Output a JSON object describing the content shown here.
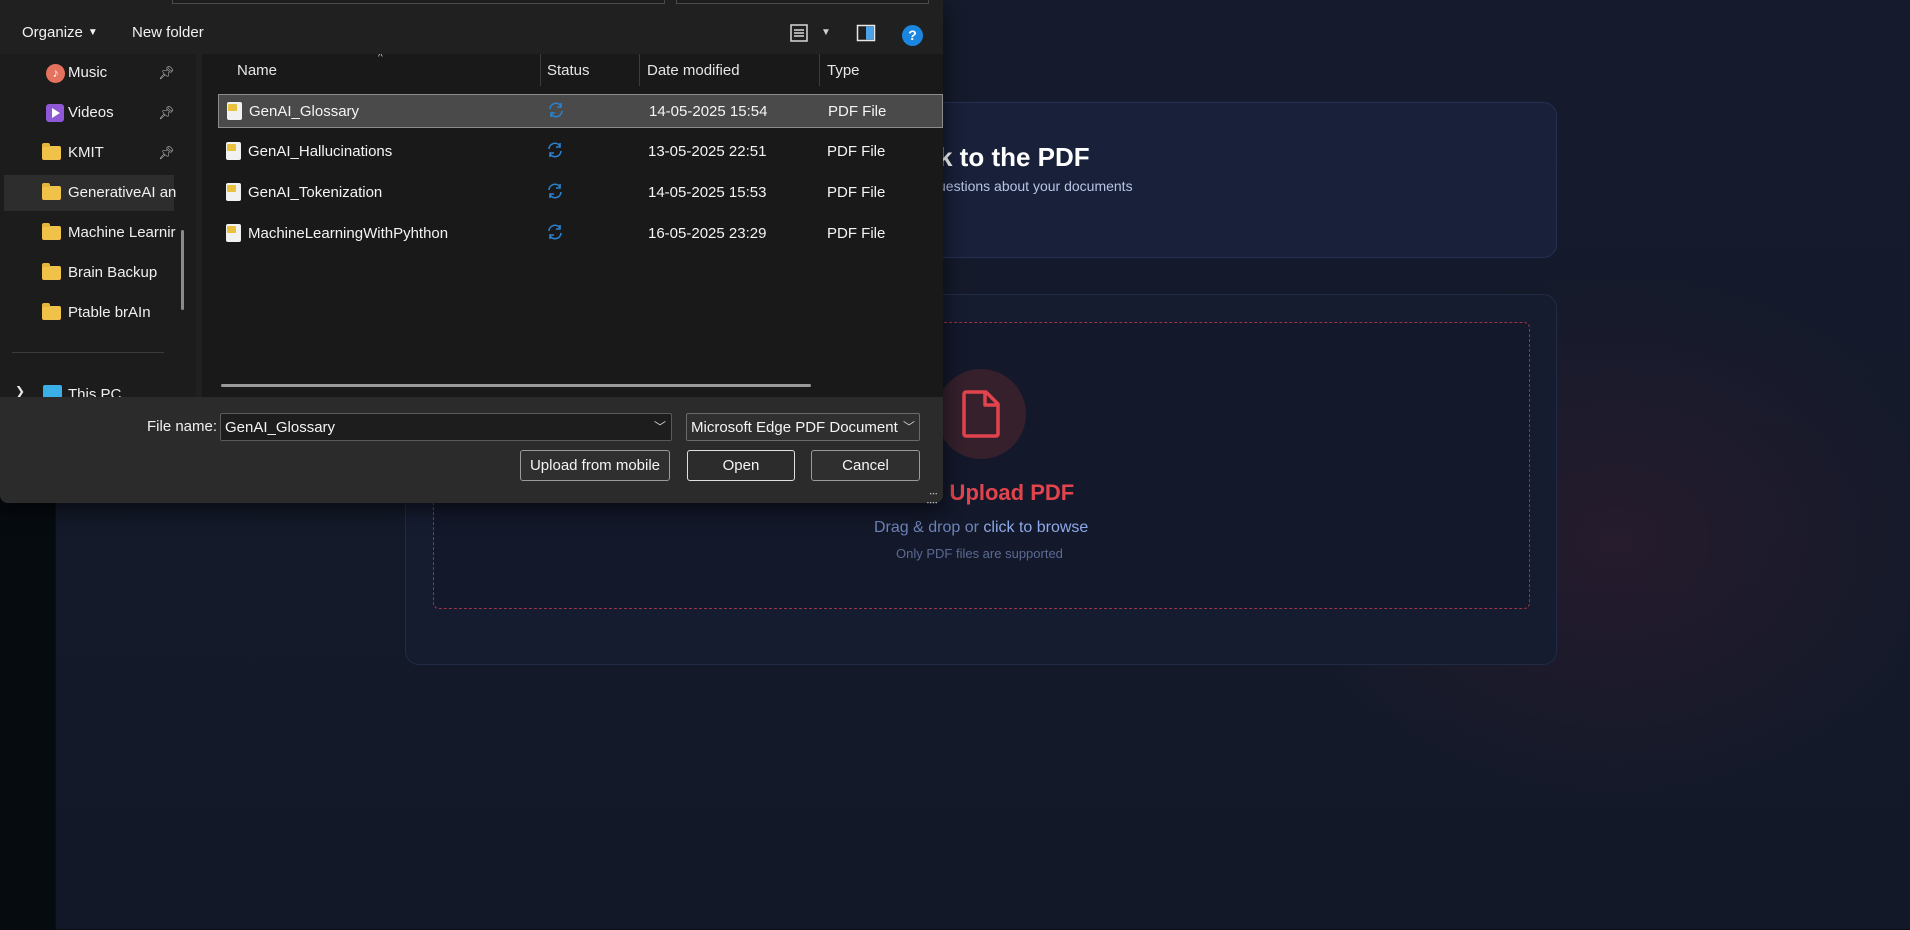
{
  "app": {
    "hero_title": "k to the PDF",
    "hero_subtitle": "uestions about your documents",
    "upload_title": "o Upload PDF",
    "upload_hint_prefix": "Drag & drop or ",
    "upload_hint_link": "click to browse",
    "upload_note": "Only PDF files are supported",
    "accent_color": "#e2444e"
  },
  "dialog": {
    "toolbar": {
      "organize_label": "Organize",
      "new_folder_label": "New folder",
      "help_label": "?"
    },
    "nav": {
      "items": [
        {
          "label": "Music",
          "icon": "music-icon",
          "pinned": true
        },
        {
          "label": "Videos",
          "icon": "video-icon",
          "pinned": true
        },
        {
          "label": "KMIT",
          "icon": "folder-icon",
          "pinned": true
        },
        {
          "label": "GenerativeAI an",
          "icon": "folder-icon",
          "pinned": false,
          "selected": true
        },
        {
          "label": "Machine Learnir",
          "icon": "folder-icon",
          "pinned": false
        },
        {
          "label": "Brain Backup",
          "icon": "folder-icon",
          "pinned": false
        },
        {
          "label": "Ptable brAIn",
          "icon": "folder-icon",
          "pinned": false
        }
      ],
      "this_pc_label": "This PC"
    },
    "columns": {
      "name": "Name",
      "status": "Status",
      "date": "Date modified",
      "type": "Type"
    },
    "files": [
      {
        "name": "GenAI_Glossary",
        "date": "14-05-2025 15:54",
        "type": "PDF File",
        "selected": true
      },
      {
        "name": "GenAI_Hallucinations",
        "date": "13-05-2025 22:51",
        "type": "PDF File"
      },
      {
        "name": "GenAI_Tokenization",
        "date": "14-05-2025 15:53",
        "type": "PDF File"
      },
      {
        "name": "MachineLearningWithPyhthon",
        "date": "16-05-2025 23:29",
        "type": "PDF File"
      }
    ],
    "footer": {
      "file_name_label": "File name:",
      "file_name_value": "GenAI_Glossary",
      "file_type_value": "Microsoft Edge PDF Document",
      "upload_mobile_label": "Upload from mobile",
      "open_label": "Open",
      "cancel_label": "Cancel"
    }
  }
}
